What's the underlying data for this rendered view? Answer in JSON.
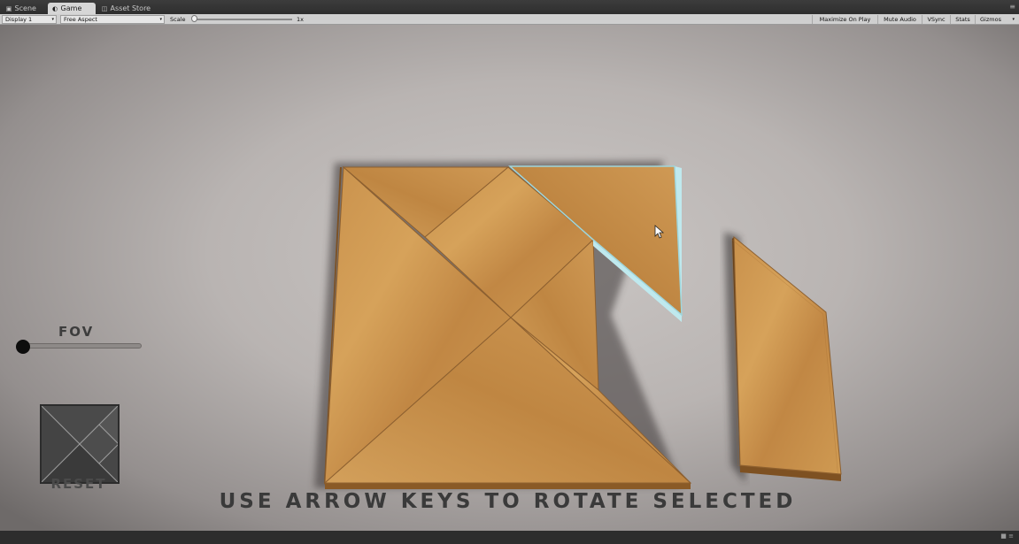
{
  "tabs": [
    {
      "label": "Scene",
      "icon": "scene-icon",
      "active": false
    },
    {
      "label": "Game",
      "icon": "game-icon",
      "active": true
    },
    {
      "label": "Asset Store",
      "icon": "asset-store-icon",
      "active": false
    }
  ],
  "toolbar": {
    "display": "Display 1",
    "aspect": "Free Aspect",
    "scale_label": "Scale",
    "scale_value": "1x",
    "scale_level": 0,
    "maximize_on_play": "Maximize On Play",
    "mute_audio": "Mute Audio",
    "vsync": "VSync",
    "stats": "Stats",
    "gizmos": "Gizmos"
  },
  "game": {
    "fov_label": "FOV",
    "fov_level": 0,
    "reset_label": "RESET",
    "instruction": "USE ARROW KEYS TO ROTATE SELECTED",
    "selected_highlight_color": "#bfe9ee",
    "wood_color": "#c48c47"
  }
}
